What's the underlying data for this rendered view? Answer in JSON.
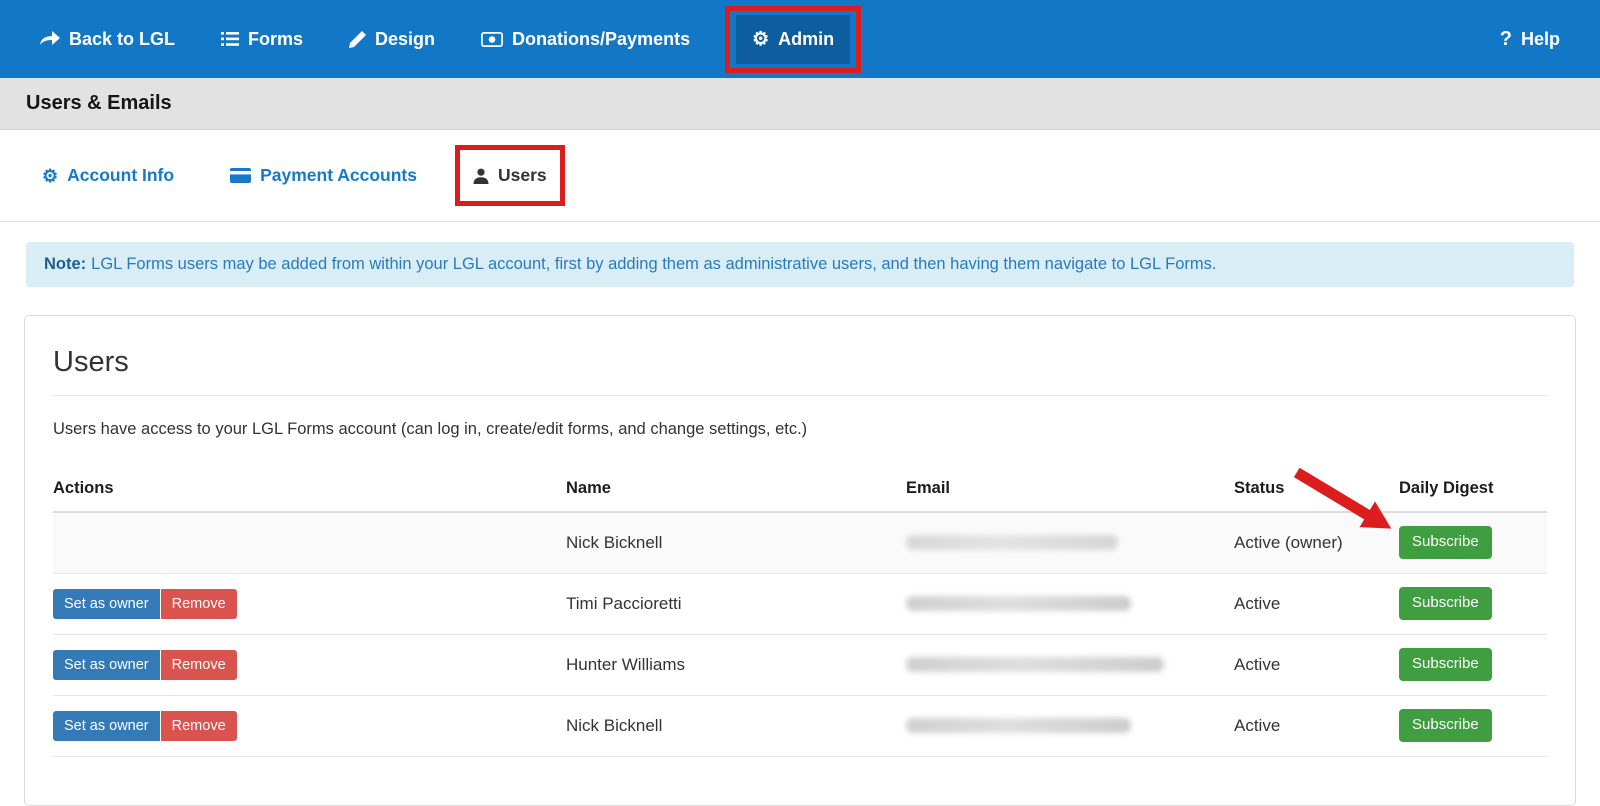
{
  "nav": {
    "items": [
      {
        "label": "Back to LGL",
        "icon": "reply-arrow"
      },
      {
        "label": "Forms",
        "icon": "list"
      },
      {
        "label": "Design",
        "icon": "pencil"
      },
      {
        "label": "Donations/Payments",
        "icon": "money"
      },
      {
        "label": "Admin",
        "icon": "gear",
        "active": true
      }
    ],
    "help": {
      "label": "Help",
      "icon": "question"
    }
  },
  "page_title": "Users & Emails",
  "tabs": [
    {
      "label": "Account Info",
      "icon": "gear"
    },
    {
      "label": "Payment Accounts",
      "icon": "credit-card"
    },
    {
      "label": "Users",
      "icon": "person",
      "active": true
    }
  ],
  "note": {
    "prefix": "Note:",
    "text": "LGL Forms users may be added from within your LGL account, first by adding them as administrative users, and then having them navigate to LGL Forms."
  },
  "users_panel": {
    "title": "Users",
    "description": "Users have access to your LGL Forms account (can log in, create/edit forms, and change settings, etc.)",
    "table": {
      "headers": [
        "Actions",
        "Name",
        "Email",
        "Status",
        "Daily Digest"
      ],
      "rows": [
        {
          "actions": [],
          "name": "Nick Bicknell",
          "email_blurred": true,
          "status": "Active (owner)",
          "daily_digest_button": "Subscribe",
          "annotated": true
        },
        {
          "actions": [
            "Set as owner",
            "Remove"
          ],
          "name": "Timi Paccioretti",
          "email_blurred": true,
          "status": "Active",
          "daily_digest_button": "Subscribe"
        },
        {
          "actions": [
            "Set as owner",
            "Remove"
          ],
          "name": "Hunter Williams",
          "email_blurred": true,
          "status": "Active",
          "daily_digest_button": "Subscribe"
        },
        {
          "actions": [
            "Set as owner",
            "Remove"
          ],
          "name": "Nick Bicknell",
          "email_blurred": true,
          "status": "Active",
          "daily_digest_button": "Subscribe"
        }
      ]
    }
  },
  "annotations": {
    "admin_nav_box": true,
    "users_tab_box": true,
    "arrow_to_first_subscribe": true,
    "color": "#dc1d1d"
  },
  "colors": {
    "nav_bg": "#1377c8",
    "nav_active_bg": "#0e5d9e",
    "titlebar_bg": "#e2e2e2",
    "note_bg": "#d9edf7",
    "note_text": "#2a7ab9",
    "button_blue": "#337ab7",
    "button_red": "#d9534f",
    "button_green": "#3f9e3f",
    "annotation_red": "#dc1d1d"
  }
}
